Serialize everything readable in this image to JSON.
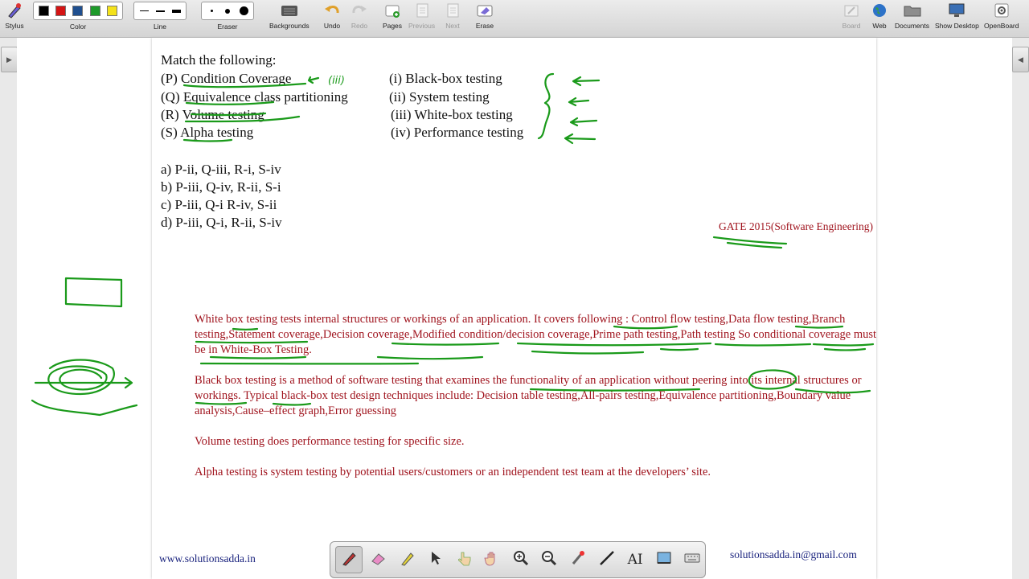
{
  "toolbar": {
    "stylus": "Stylus",
    "color": "Color",
    "line": "Line",
    "eraser": "Eraser",
    "backgrounds": "Backgrounds",
    "undo": "Undo",
    "redo": "Redo",
    "pages": "Pages",
    "previous": "Previous",
    "next": "Next",
    "erase": "Erase",
    "board": "Board",
    "web": "Web",
    "documents": "Documents",
    "show_desktop": "Show Desktop",
    "openboard": "OpenBoard",
    "colors": [
      "#000000",
      "#d41414",
      "#1f4f8f",
      "#1e9a2a",
      "#f4e21a"
    ]
  },
  "question": {
    "heading": "Match the following:",
    "left": [
      "(P) Condition Coverage",
      "(Q) Equivalence class partitioning",
      "(R) Volume testing",
      "(S) Alpha testing"
    ],
    "right": [
      "(i) Black-box testing",
      "(ii) System testing",
      "(iii) White-box testing",
      "(iv) Performance testing"
    ],
    "options": [
      "a) P-ii, Q-iii, R-i, S-iv",
      "b) P-iii, Q-iv, R-ii, S-i",
      "c) P-iii, Q-i R-iv, S-ii",
      "d) P-iii, Q-i, R-ii, S-iv"
    ],
    "source": "GATE 2015(Software Engineering)"
  },
  "explanation": {
    "white_box": "White box testing  tests internal structures or workings of an application. It covers following : Control flow testing,Data flow testing,Branch testing,Statement coverage,Decision coverage,Modified condition/decision coverage,Prime path testing,Path testing So conditional coverage must be in White-Box Testing.",
    "black_box": "Black box testing is a method of software testing that examines the functionality of an application without peering into its internal structures or workings. Typical black-box test design techniques include: Decision table testing,All-pairs testing,Equivalence partitioning,Boundary value analysis,Cause–effect graph,Error guessing",
    "volume": "Volume testing  does performance testing for specific size.",
    "alpha": "Alpha testing is system testing by potential users/customers or an independent test team at the developers’ site."
  },
  "annotation": {
    "handwritten": "(iii)"
  },
  "footer": {
    "website": "www.solutionsadda.in",
    "email": "solutionsadda.in@gmail.com"
  },
  "ink_color": "#1a9a1a"
}
